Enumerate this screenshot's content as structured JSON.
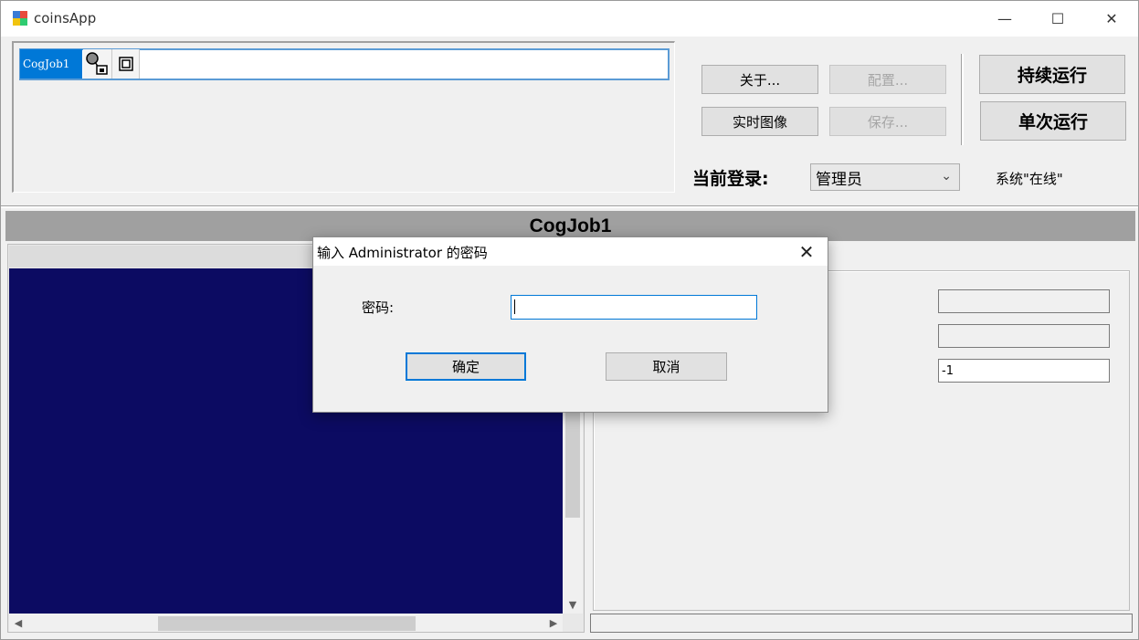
{
  "window": {
    "title": "coinsApp",
    "controls": {
      "minimize": "—",
      "maximize": "☐",
      "close": "✕"
    }
  },
  "job_list": {
    "selected_job": "CogJob1"
  },
  "toolbar": {
    "about_label": "关于...",
    "config_label": "配置...",
    "live_image_label": "实时图像",
    "save_label": "保存...",
    "continuous_run_label": "持续运行",
    "single_run_label": "单次运行"
  },
  "login": {
    "label": "当前登录:",
    "current_role": "管理员",
    "system_status": "系统\"在线\""
  },
  "job_display": {
    "header": "CogJob1"
  },
  "results": {
    "field1": "",
    "field2": "",
    "field3": "-1"
  },
  "dialog": {
    "title": "输入 Administrator 的密码",
    "password_label": "密码:",
    "password_value": "",
    "ok_label": "确定",
    "cancel_label": "取消"
  },
  "colors": {
    "accent": "#0078d7",
    "image_background": "#0c0b62",
    "header_gray": "#a0a0a0"
  }
}
